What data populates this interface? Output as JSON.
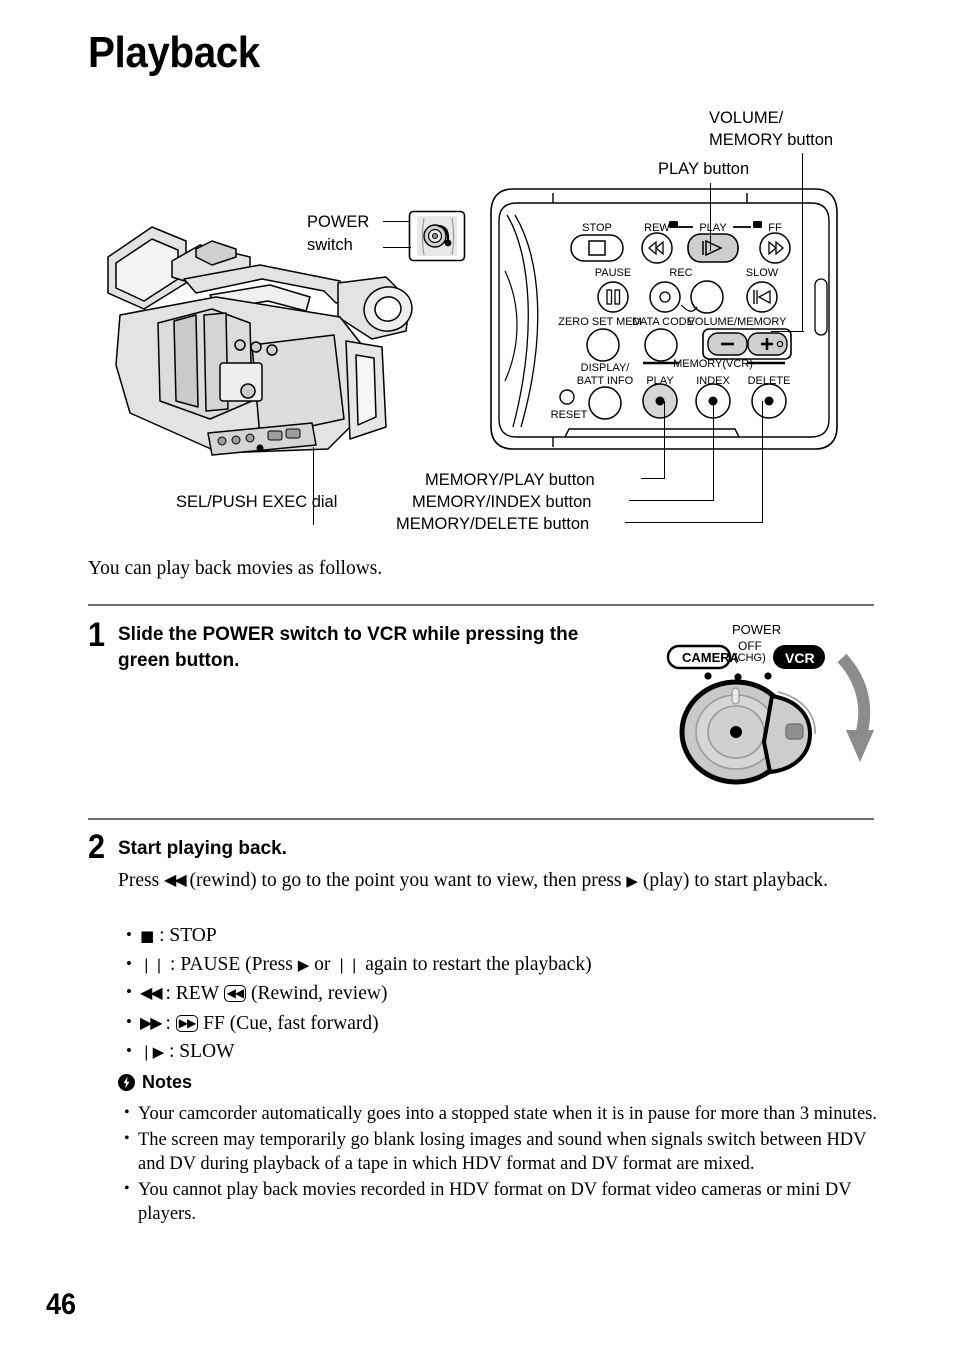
{
  "page": {
    "title": "Playback",
    "number": "46"
  },
  "figure": {
    "callouts": {
      "volume_memory": "VOLUME/",
      "volume_memory2": "MEMORY button",
      "play_button": "PLAY button",
      "power_switch": "POWER",
      "power_switch2": "switch",
      "sel_push_exec": "SEL/PUSH EXEC dial",
      "memory_play": "MEMORY/PLAY button",
      "memory_index": "MEMORY/INDEX button",
      "memory_delete": "MEMORY/DELETE button"
    },
    "panel_labels": {
      "stop": "STOP",
      "rew": "REW",
      "play": "PLAY",
      "ff": "FF",
      "pause": "PAUSE",
      "rec": "REC",
      "slow": "SLOW",
      "zero_set_mem": "ZERO SET MEM",
      "data_code": "DATA CODE",
      "volume_memory": "VOLUME/MEMORY",
      "display_batt_info1": "DISPLAY/",
      "display_batt_info2": "BATT INFO",
      "memory_vcr": "MEMORY(VCR)",
      "mem_play": "PLAY",
      "mem_index": "INDEX",
      "mem_delete": "DELETE",
      "reset": "RESET",
      "minus": "–",
      "plus": "+"
    }
  },
  "intro": "You can play back movies as follows.",
  "steps": [
    {
      "number": "1",
      "heading_line1": "Slide the POWER switch to VCR while pressing the",
      "heading_line2": "green button."
    },
    {
      "number": "2",
      "heading_line1": "Start playing back."
    }
  ],
  "power_dial": {
    "power_label": "POWER",
    "camera_label": "CAMERA",
    "off_label": "OFF",
    "chg_label": "(CHG)",
    "vcr_label": "VCR"
  },
  "step2": {
    "body_pre": "Press ",
    "rewind_glyph": "◀◀",
    "body_mid": " (rewind) to go to the point you want to view, then press ",
    "play_glyph": "▶",
    "body_post": " (play) to start playback.",
    "bullets": [
      {
        "glyph": "■",
        "sep": " : ",
        "label": "STOP",
        "extra": ""
      },
      {
        "glyph": "❘❘",
        "sep": " : ",
        "label": "PAUSE (Press ",
        "extra": "▶",
        "extra2": " or ",
        "extra3": "❘❘",
        "extra4": " again to restart the playback)"
      },
      {
        "glyph": "◀◀",
        "sep": " : ",
        "label": "REW ",
        "boxed": "◀◀",
        "after": " (Rewind, review)"
      },
      {
        "glyph": "▶▶",
        "sep": " : ",
        "boxed": "▶▶",
        "after": " FF (Cue, fast forward)"
      },
      {
        "glyph": "❘▶",
        "sep": " : ",
        "label": "SLOW",
        "extra": ""
      }
    ]
  },
  "notes": {
    "heading": "Notes",
    "items": [
      "Your camcorder automatically goes into a stopped state when it is in pause for more than 3 minutes.",
      "The screen may temporarily go blank losing images and sound when signals switch between HDV and DV during playback of a tape in which HDV format and DV format are mixed.",
      "You cannot play back movies recorded in HDV format on DV format video cameras or mini DV players."
    ]
  },
  "colors": {
    "divider": "#6f6f6f",
    "panel_fill": "#ffffff",
    "button_highlight": "#cfcfcf",
    "art_gray": "#d9d9d9",
    "arrow_gray": "#8c8c8c"
  }
}
